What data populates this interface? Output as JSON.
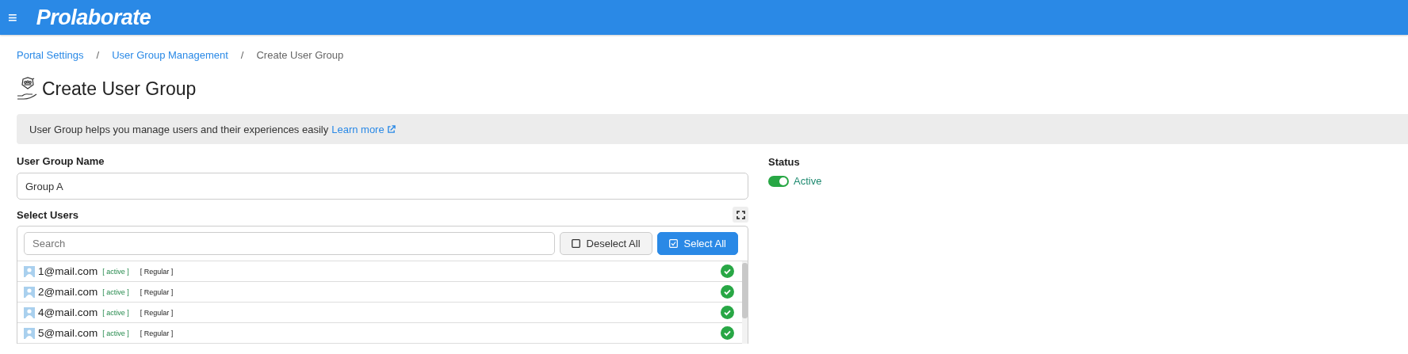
{
  "header": {
    "menu_icon": "≡",
    "logo": "Prolaborate"
  },
  "breadcrumb": [
    {
      "label": "Portal Settings",
      "kind": "link"
    },
    {
      "label": "User Group Management",
      "kind": "link"
    },
    {
      "label": "Create User Group",
      "kind": "current"
    }
  ],
  "breadcrumb_separator": "/",
  "title": "Create User Group",
  "info": {
    "text": "User Group helps you manage users and their experiences easily",
    "link": "Learn more"
  },
  "name_field": {
    "label": "User Group Name",
    "value": "Group A"
  },
  "status": {
    "label": "Status",
    "on": true,
    "text": "Active"
  },
  "select_users": {
    "label": "Select Users",
    "search_placeholder": "Search",
    "deselect_all": "Deselect All",
    "select_all": "Select All",
    "users": [
      {
        "email": "1@mail.com",
        "state": "[ active ]",
        "role": "[ Regular ]",
        "selected": true
      },
      {
        "email": "2@mail.com",
        "state": "[ active ]",
        "role": "[ Regular ]",
        "selected": true
      },
      {
        "email": "4@mail.com",
        "state": "[ active ]",
        "role": "[ Regular ]",
        "selected": true
      },
      {
        "email": "5@mail.com",
        "state": "[ active ]",
        "role": "[ Regular ]",
        "selected": true
      }
    ]
  }
}
